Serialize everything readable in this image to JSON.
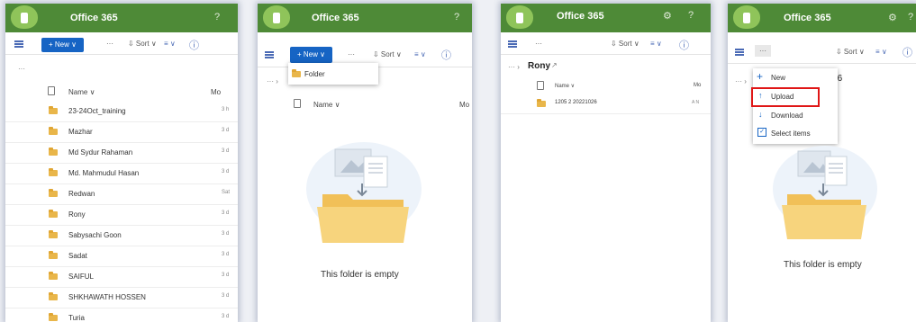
{
  "panel1": {
    "app_title": "Office 365",
    "help": "?",
    "new_label": "+ New ∨",
    "more": "···",
    "sort_label": "⇩ Sort ∨",
    "view_label": "≡ ∨",
    "info": "ⓘ",
    "breadcrumb_more": "···",
    "col_name": "Name ∨",
    "col_modified": "Mo",
    "rows": [
      {
        "name": "23-24Oct_training",
        "date": "3 h"
      },
      {
        "name": "Mazhar",
        "date": "3 d"
      },
      {
        "name": "Md Sydur Rahaman",
        "date": "3 d"
      },
      {
        "name": "Md. Mahmudul Hasan",
        "date": "3 d"
      },
      {
        "name": "Redwan",
        "date": "Sat"
      },
      {
        "name": "Rony",
        "date": "3 d"
      },
      {
        "name": "Sabysachi Goon",
        "date": "3 d"
      },
      {
        "name": "Sadat",
        "date": "3 d"
      },
      {
        "name": "SAIFUL",
        "date": "3 d"
      },
      {
        "name": "SHKHAWATH HOSSEN",
        "date": "3 d"
      },
      {
        "name": "Turia",
        "date": "3 d"
      }
    ]
  },
  "panel2": {
    "app_title": "Office 365",
    "help": "?",
    "new_label": "+ New ∨",
    "more": "···",
    "sort_label": "⇩ Sort ∨",
    "view_label": "≡ ∨",
    "info": "ⓘ",
    "breadcrumb": "··· ›",
    "menu_folder": "Folder",
    "col_name": "Name ∨",
    "col_modified": "Mo",
    "empty_text": "This folder is empty"
  },
  "panel3": {
    "app_title": "Office 365",
    "gear": "⚙",
    "help": "?",
    "more": "···",
    "sort_label": "⇩ Sort ∨",
    "view_label": "≡ ∨",
    "info": "ⓘ",
    "breadcrumb_prefix": "··· ›",
    "breadcrumb_current": "Rony",
    "share": "↗",
    "col_name": "Name ∨",
    "col_modified": "Mo",
    "row_name": "1205 2 20221026",
    "row_date": "A N"
  },
  "panel4": {
    "app_title": "Office 365",
    "gear": "⚙",
    "help": "?",
    "more": "···",
    "sort_label": "⇩ Sort ∨",
    "view_label": "≡ ∨",
    "info": "ⓘ",
    "breadcrumb_prefix": "··· ›",
    "breadcrumb_tail": "› 26",
    "menu_new": "New",
    "menu_upload": "Upload",
    "menu_download": "Download",
    "menu_select": "Select items",
    "empty_text": "This folder is empty"
  }
}
